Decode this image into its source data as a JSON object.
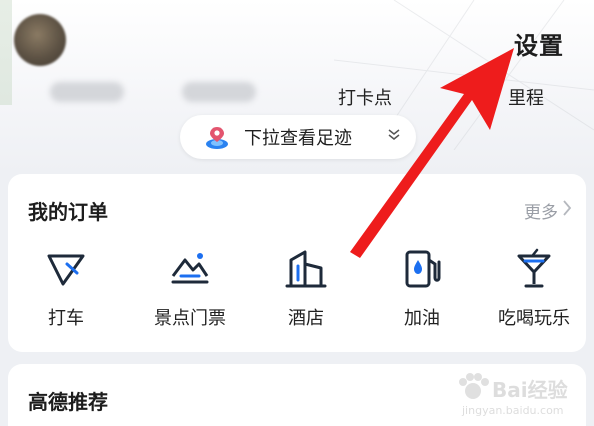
{
  "header": {
    "settings_label": "设置",
    "stats": [
      {
        "label": "打卡点"
      },
      {
        "label": "里程"
      }
    ],
    "pull_down_label": "下拉查看足迹"
  },
  "orders": {
    "title": "我的订单",
    "more_label": "更多",
    "services": [
      {
        "label": "打车",
        "icon": "taxi-icon"
      },
      {
        "label": "景点门票",
        "icon": "scenic-ticket-icon"
      },
      {
        "label": "酒店",
        "icon": "hotel-icon"
      },
      {
        "label": "加油",
        "icon": "fuel-icon"
      },
      {
        "label": "吃喝玩乐",
        "icon": "cocktail-icon"
      }
    ]
  },
  "recommend": {
    "title": "高德推荐"
  },
  "watermark": {
    "brand": "Bai经验",
    "url": "jingyan.baidu.com"
  },
  "colors": {
    "accent_blue": "#1c6ff0",
    "annotation_red": "#ee1c1c"
  }
}
